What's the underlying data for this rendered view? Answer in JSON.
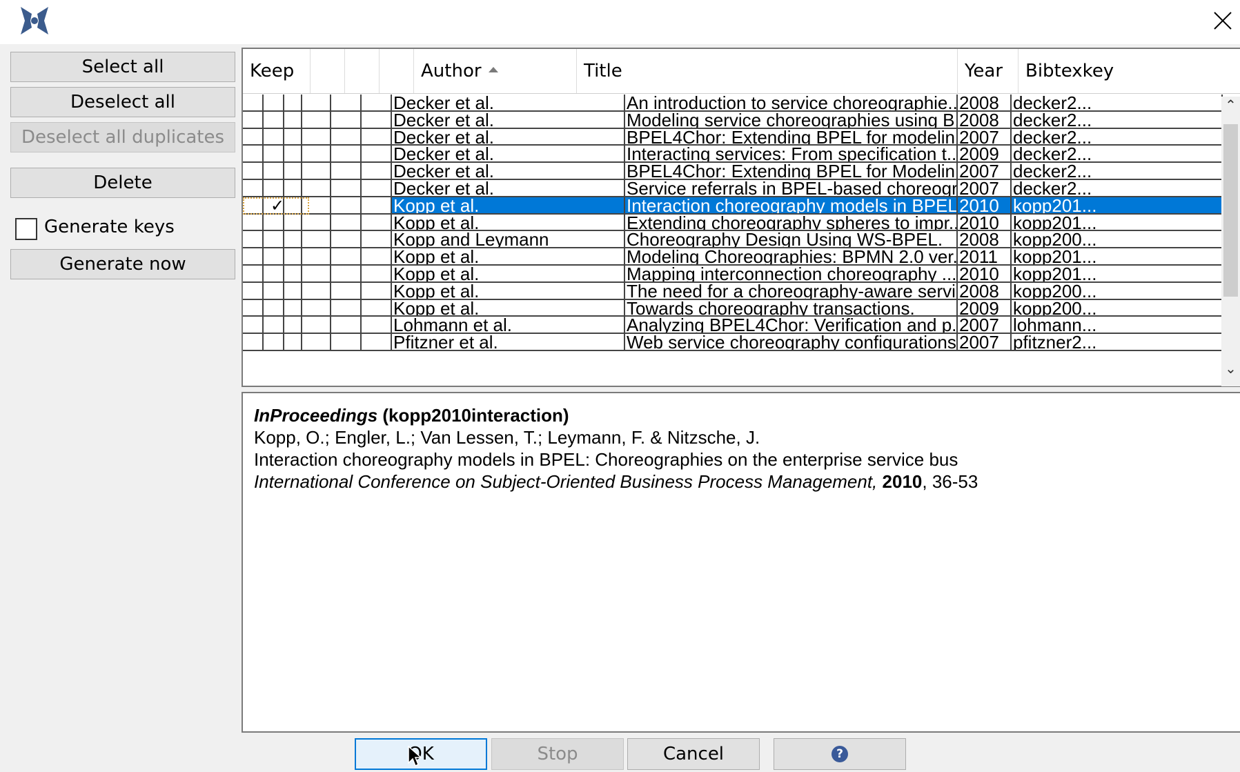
{
  "window": {
    "app_icon": "jabref-logo-icon",
    "close_icon": "close-icon"
  },
  "left_panel": {
    "select_all": "Select all",
    "deselect_all": "Deselect all",
    "deselect_all_duplicates": "Deselect all duplicates",
    "delete": "Delete",
    "generate_keys": "Generate keys",
    "generate_keys_checked": false,
    "generate_now": "Generate now"
  },
  "table": {
    "columns": {
      "keep": "Keep",
      "author": "Author",
      "title": "Title",
      "year": "Year",
      "bibtexkey": "Bibtexkey"
    },
    "sort_column": "Author",
    "sort_direction": "ascending",
    "rows": [
      {
        "author": "Decker et al.",
        "title": "An introduction to service choreographie...",
        "year": "2008",
        "key": "decker2...",
        "keep": false,
        "selected": false
      },
      {
        "author": "Decker et al.",
        "title": "Modeling service choreographies using B...",
        "year": "2008",
        "key": "decker2...",
        "keep": false,
        "selected": false
      },
      {
        "author": "Decker et al.",
        "title": "BPEL4Chor: Extending BPEL for modelin...",
        "year": "2007",
        "key": "decker2...",
        "keep": false,
        "selected": false
      },
      {
        "author": "Decker et al.",
        "title": "Interacting services: From specification t...",
        "year": "2009",
        "key": "decker2...",
        "keep": false,
        "selected": false
      },
      {
        "author": "Decker et al.",
        "title": "BPEL4Chor: Extending BPEL for Modelin...",
        "year": "2007",
        "key": "decker2...",
        "keep": false,
        "selected": false
      },
      {
        "author": "Decker et al.",
        "title": "Service referrals in BPEL-based choreogr...",
        "year": "2007",
        "key": "decker2...",
        "keep": false,
        "selected": false
      },
      {
        "author": "Kopp et al.",
        "title": "Interaction choreography models in BPEL...",
        "year": "2010",
        "key": "kopp201...",
        "keep": true,
        "selected": true
      },
      {
        "author": "Kopp et al.",
        "title": "Extending choreography spheres to impr...",
        "year": "2010",
        "key": "kopp201...",
        "keep": false,
        "selected": false
      },
      {
        "author": "Kopp and Leymann",
        "title": "Choreography Design Using WS-BPEL.",
        "year": "2008",
        "key": "kopp200...",
        "keep": false,
        "selected": false
      },
      {
        "author": "Kopp et al.",
        "title": "Modeling Choreographies: BPMN 2.0 ver...",
        "year": "2011",
        "key": "kopp201...",
        "keep": false,
        "selected": false
      },
      {
        "author": "Kopp et al.",
        "title": "Mapping interconnection choreography ...",
        "year": "2010",
        "key": "kopp201...",
        "keep": false,
        "selected": false
      },
      {
        "author": "Kopp et al.",
        "title": "The need for a choreography-aware servi...",
        "year": "2008",
        "key": "kopp200...",
        "keep": false,
        "selected": false
      },
      {
        "author": "Kopp et al.",
        "title": "Towards choreography transactions.",
        "year": "2009",
        "key": "kopp200...",
        "keep": false,
        "selected": false
      },
      {
        "author": "Lohmann et al.",
        "title": "Analyzing BPEL4Chor: Verification and p...",
        "year": "2007",
        "key": "lohmann...",
        "keep": false,
        "selected": false
      },
      {
        "author": "Pfitzner et al.",
        "title": "Web service choreography configurations...",
        "year": "2007",
        "key": "pfitzner2...",
        "keep": false,
        "selected": false
      }
    ]
  },
  "preview": {
    "entry_type": "InProceedings",
    "entry_key": "(kopp2010interaction)",
    "authors": "Kopp, O.; Engler, L.; Van Lessen, T.; Leymann, F. & Nitzsche, J.",
    "title": "Interaction choreography models in BPEL: Choreographies on the enterprise service bus",
    "booktitle": "International Conference on Subject-Oriented Business Process Management,",
    "year": "2010",
    "pages": ", 36-53"
  },
  "bottom_bar": {
    "ok": "OK",
    "stop": "Stop",
    "cancel": "Cancel",
    "help_icon": "help-icon",
    "help_glyph": "?"
  }
}
